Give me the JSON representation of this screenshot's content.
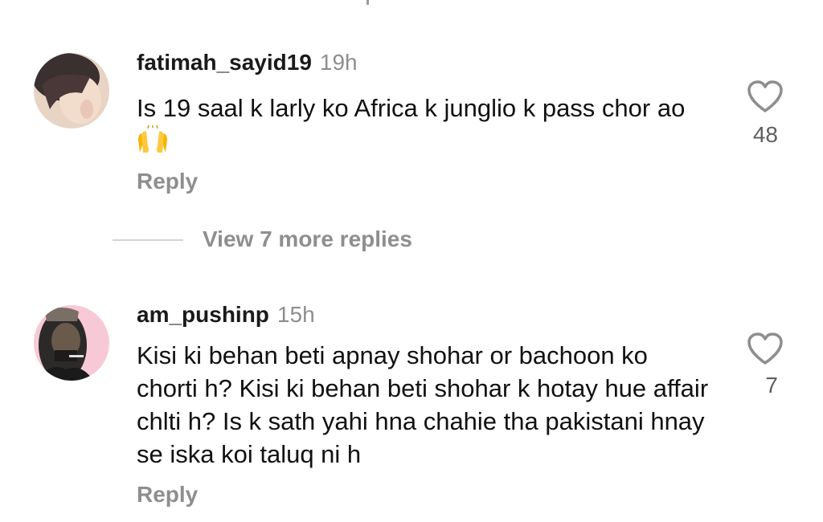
{
  "comments": [
    {
      "username": "fatimah_sayid19",
      "time": "19h",
      "text": "Is 19 saal k larly ko Africa k junglio k pass chor ao",
      "emoji": "raising-hands-emoji",
      "likes": "48",
      "reply_label": "Reply"
    },
    {
      "username": "am_pushinp",
      "time": "15h",
      "text": "Kisi ki behan beti apnay shohar or bachoon ko chorti h? Kisi ki behan beti shohar k hotay hue affair chlti h? Is k sath yahi hna chahie tha pakistani hnay se iska koi taluq ni h",
      "likes": "7",
      "reply_label": "Reply"
    }
  ],
  "view_more_label": "View 7 more replies",
  "icons": {
    "like": "heart-outline-icon"
  },
  "colors": {
    "secondary_text": "#8e8e8e",
    "divider": "#d4d4d4",
    "text": "#111111"
  }
}
